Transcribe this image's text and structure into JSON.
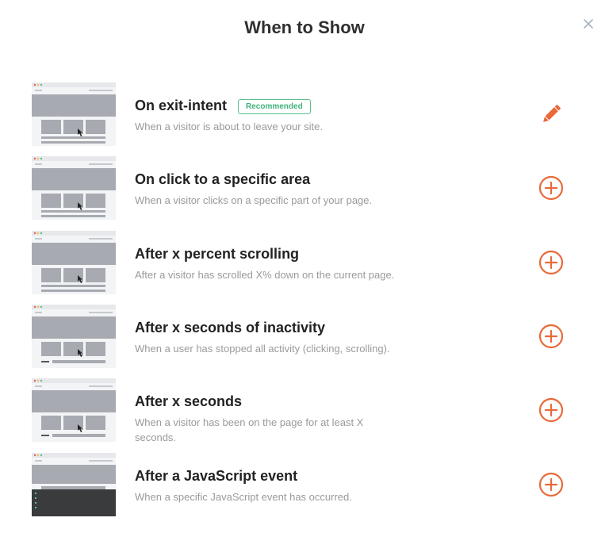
{
  "modal": {
    "title": "When to Show",
    "close_icon": "close-icon"
  },
  "colors": {
    "accent": "#e86a3a",
    "badge_green": "#3fb27a",
    "title": "#2f2f2f",
    "description": "#9a9a9a"
  },
  "options": [
    {
      "title": "On exit-intent",
      "badge": "Recommended",
      "description": "When a visitor is about to leave your site.",
      "action_icon": "pencil-icon"
    },
    {
      "title": "On click to a specific area",
      "description": "When a visitor clicks on a specific part of your page.",
      "action_icon": "plus-circle-icon"
    },
    {
      "title": "After x percent scrolling",
      "description": "After a visitor has scrolled X% down on the current page.",
      "action_icon": "plus-circle-icon"
    },
    {
      "title": "After x seconds of inactivity",
      "description": "When a user has stopped all activity (clicking, scrolling).",
      "action_icon": "plus-circle-icon"
    },
    {
      "title": "After x seconds",
      "description": "When a visitor has been on the page for at least X seconds.",
      "action_icon": "plus-circle-icon"
    },
    {
      "title": "After a JavaScript event",
      "description": "When a specific JavaScript event has occurred.",
      "action_icon": "plus-circle-icon"
    }
  ]
}
